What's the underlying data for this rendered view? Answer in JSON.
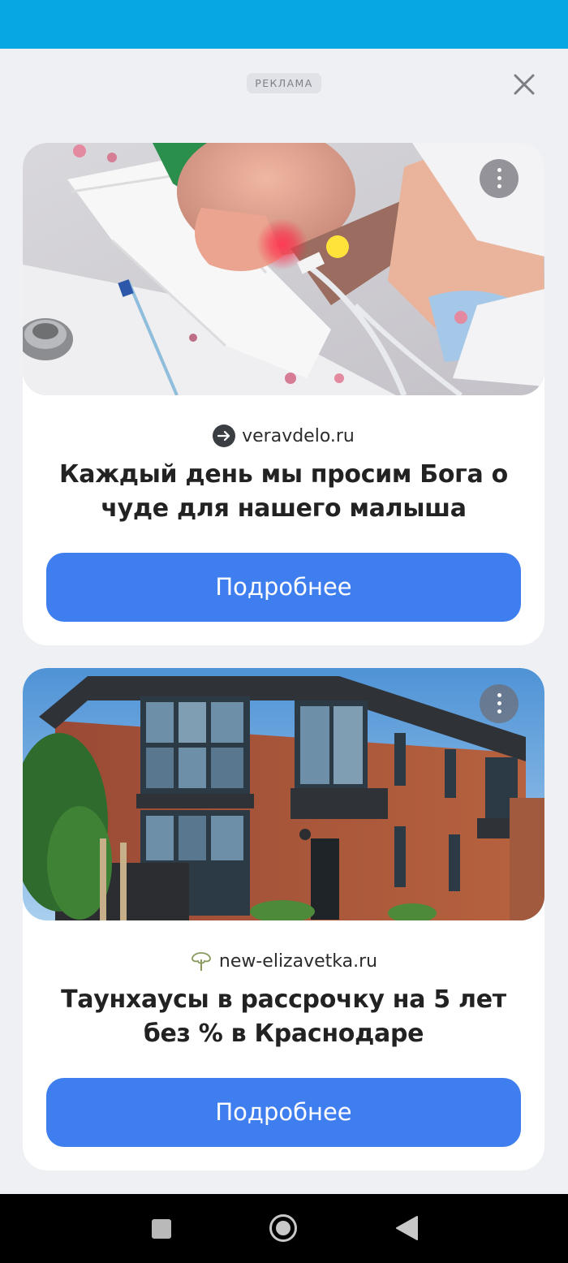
{
  "ad_label": "РЕКЛАМА",
  "colors": {
    "status_bar": "#05a8e3",
    "background": "#eef0f4",
    "cta_button": "#3f7eef",
    "nav_bar": "#000000"
  },
  "icons": {
    "close": "close-icon",
    "menu": "more-vertical-icon",
    "source_1": "arrow-right-circle-icon",
    "source_2": "tree-logo-icon",
    "nav_recents": "square-icon",
    "nav_home": "circle-icon",
    "nav_back": "triangle-back-icon"
  },
  "ads": [
    {
      "source": "veravdelo.ru",
      "title": "Каждый день мы просим Бога о чуде для нашего малыша",
      "button_label": "Подробнее"
    },
    {
      "source": "new-elizavetka.ru",
      "title": "Таунхаусы в рассрочку на 5 лет без % в Краснодаре",
      "button_label": "Подробнее"
    }
  ]
}
